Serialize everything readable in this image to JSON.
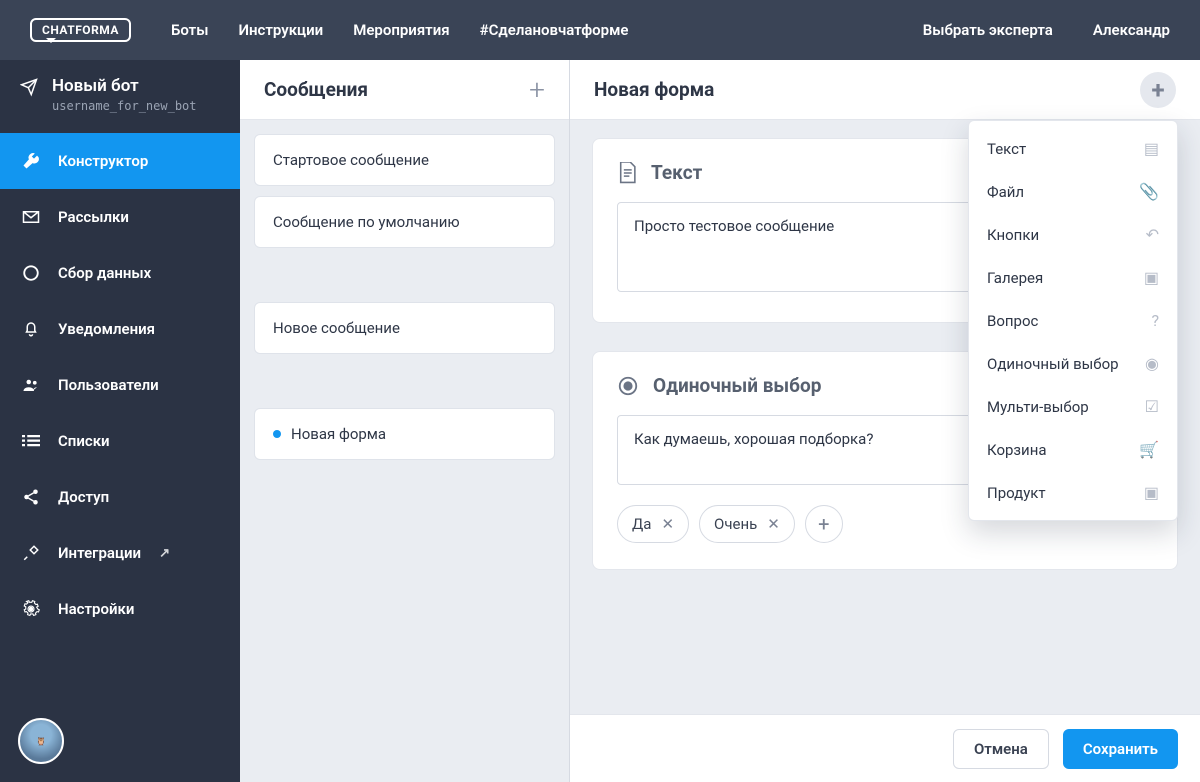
{
  "topbar": {
    "logo": "CHATFORMA",
    "nav": [
      "Боты",
      "Инструкции",
      "Мероприятия",
      "#Сделановчатформе"
    ],
    "expert": "Выбрать эксперта",
    "user": "Александр"
  },
  "bot": {
    "title": "Новый бот",
    "username": "username_for_new_bot"
  },
  "sidebar": {
    "items": [
      {
        "label": "Конструктор",
        "active": true
      },
      {
        "label": "Рассылки"
      },
      {
        "label": "Сбор данных"
      },
      {
        "label": "Уведомления"
      },
      {
        "label": "Пользователи"
      },
      {
        "label": "Списки"
      },
      {
        "label": "Доступ"
      },
      {
        "label": "Интеграции",
        "ext": true
      },
      {
        "label": "Настройки"
      }
    ]
  },
  "messages": {
    "header": "Сообщения",
    "items": [
      "Стартовое сообщение",
      "Сообщение по умолчанию",
      "Новое сообщение",
      "Новая форма"
    ]
  },
  "form": {
    "header": "Новая форма",
    "text_block": {
      "title": "Текст",
      "value": "Просто тестовое сообщение"
    },
    "single_block": {
      "title": "Одиночный выбор",
      "value": "Как думаешь, хорошая подборка?",
      "chips": [
        "Да",
        "Очень"
      ]
    }
  },
  "dropdown": {
    "items": [
      "Текст",
      "Файл",
      "Кнопки",
      "Галерея",
      "Вопрос",
      "Одиночный выбор",
      "Мульти-выбор",
      "Корзина",
      "Продукт"
    ]
  },
  "footer": {
    "cancel": "Отмена",
    "save": "Сохранить"
  }
}
